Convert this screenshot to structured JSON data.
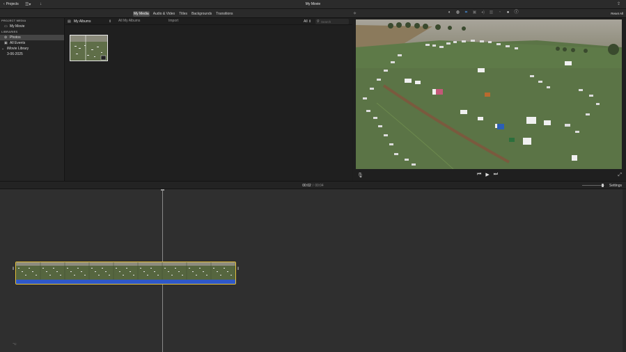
{
  "topbar": {
    "projects_label": "Projects",
    "title": "My Movie",
    "icons": [
      "chevron-left-icon",
      "clip-list-icon",
      "download-icon",
      "share-icon"
    ]
  },
  "media_tabs": [
    {
      "label": "My Media",
      "active": true
    },
    {
      "label": "Audio & Video",
      "active": false
    },
    {
      "label": "Titles",
      "active": false
    },
    {
      "label": "Backgrounds",
      "active": false
    },
    {
      "label": "Transitions",
      "active": false
    }
  ],
  "viewer_tools": {
    "reset_label": "Reset All",
    "icons": [
      "color-balance-icon",
      "color-correction-icon",
      "crop-icon",
      "stabilization-icon",
      "volume-icon",
      "noise-eq-icon",
      "speed-icon",
      "clip-filter-icon",
      "info-icon"
    ],
    "selected": "crop-icon"
  },
  "sidebar": {
    "project_media_heading": "PROJECT MEDIA",
    "project_item": "My Movie",
    "libraries_heading": "LIBRARIES",
    "photos": "Photos",
    "all_events": "All Events",
    "library": "iMovie Library",
    "event": "3-06-2025"
  },
  "browser": {
    "album_select": "My Albums",
    "all_albums": "All My Albums",
    "import": "Import",
    "filter": "All",
    "search_placeholder": "Search"
  },
  "timeline": {
    "current_time": "00:02",
    "separator": "/",
    "total_time": "00:04",
    "settings_label": "Settings"
  },
  "colors": {
    "accent": "#4da3ff",
    "clip_border": "#e8c33a",
    "audio_track": "#2f58c8"
  }
}
